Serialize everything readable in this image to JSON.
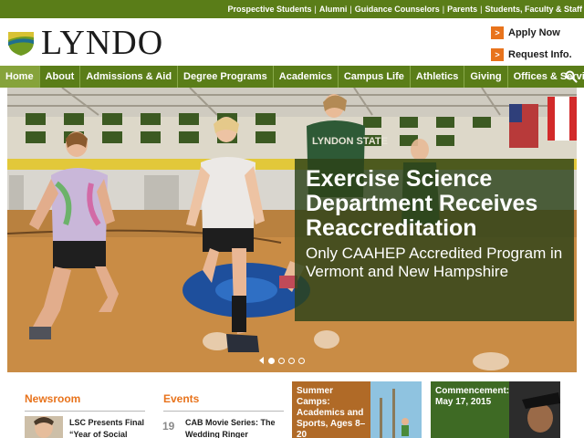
{
  "utility_nav": [
    "Prospective Students",
    "Alumni",
    "Guidance Counselors",
    "Parents",
    "Students, Faculty & Staff"
  ],
  "logo": {
    "text": "LYNDO"
  },
  "header_ctas": {
    "apply": "Apply Now",
    "request": "Request Info.",
    "arrow_glyph": ">"
  },
  "main_nav": [
    "Home",
    "About",
    "Admissions & Aid",
    "Degree Programs",
    "Academics",
    "Campus Life",
    "Athletics",
    "Giving",
    "Offices & Services"
  ],
  "main_nav_active": "Home",
  "search_icon": "search-icon",
  "hero": {
    "headline": "Exercise Science Department Receives Reaccreditation",
    "subline": "Only CAAHEP Accredited Program in Vermont and New Hampshire",
    "shirt_text": "LYNDON STATE",
    "slides_count": 4,
    "active_slide": 1
  },
  "newsroom": {
    "heading": "Newsroom",
    "item_title": "LSC Presents Final “Year of Social"
  },
  "events": {
    "heading": "Events",
    "day": "19",
    "item_title": "CAB Movie Series: The Wedding Ringer"
  },
  "promo_camps": {
    "label": "Summer Camps: Academics and Sports, Ages 8–20"
  },
  "promo_commencement": {
    "label": "Commencement: May 17, 2015"
  },
  "colors": {
    "brand_green": "#5a7d18",
    "nav_active": "#86a33b",
    "accent_orange": "#e8731c",
    "caption_bg": "#2c4218"
  }
}
